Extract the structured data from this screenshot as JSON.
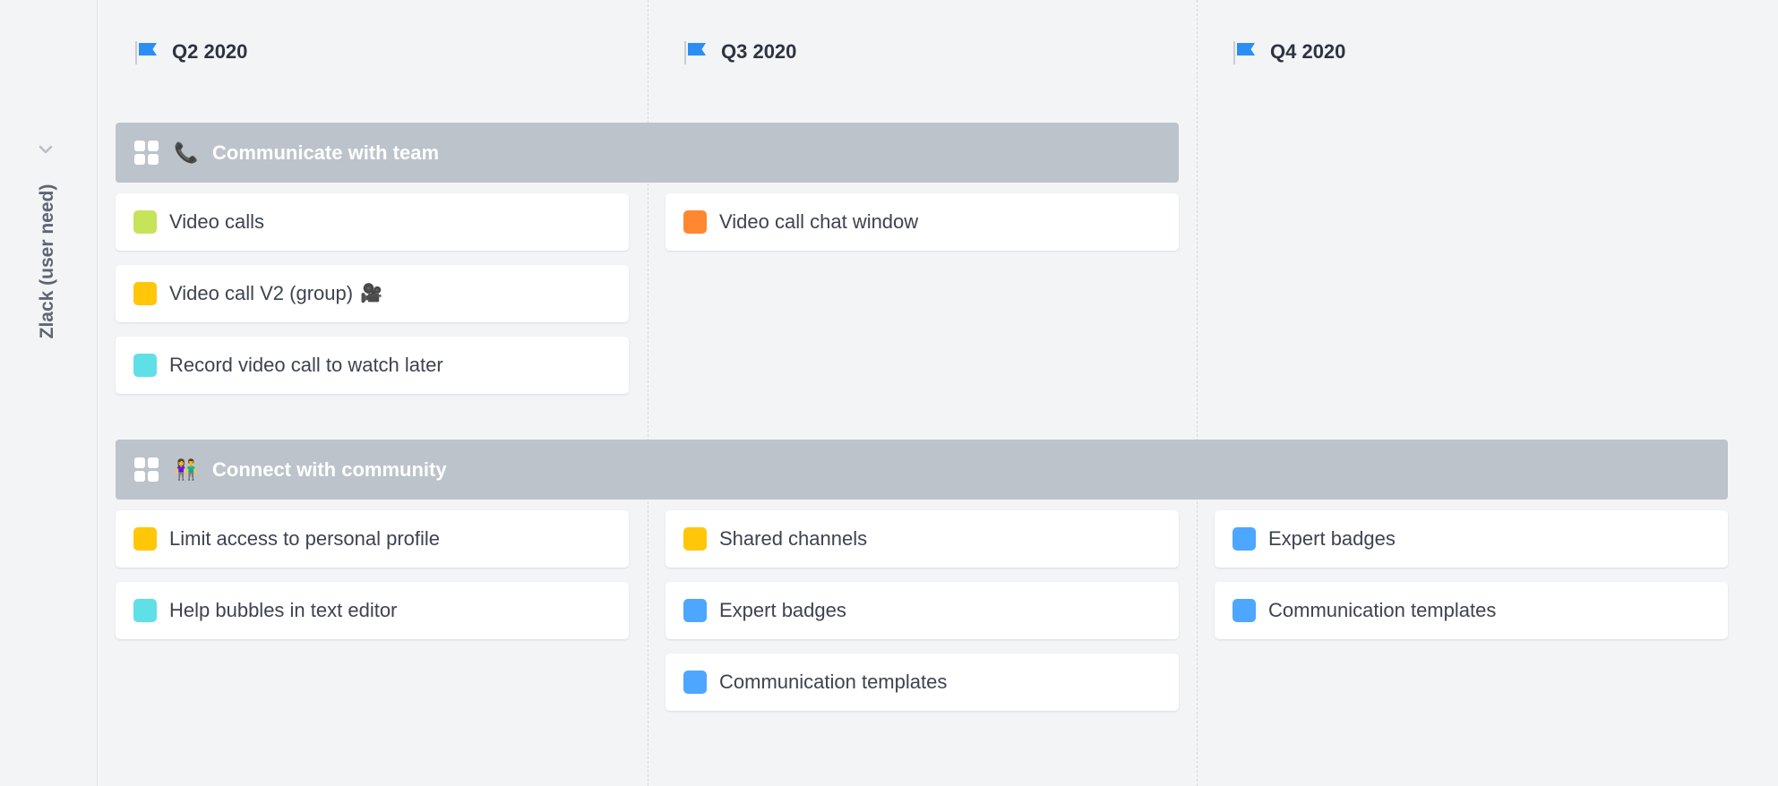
{
  "row": {
    "label": "Zlack (user need)"
  },
  "columns": [
    {
      "label": "Q2 2020",
      "flag_icon": "flag-icon"
    },
    {
      "label": "Q3 2020",
      "flag_icon": "flag-icon"
    },
    {
      "label": "Q4 2020",
      "flag_icon": "flag-icon"
    }
  ],
  "groups": [
    {
      "label": "Communicate with team",
      "icon": "phone-icon",
      "emoji": "📞",
      "cards": [
        {
          "label": "Video calls",
          "color": "#c7e35a",
          "column": "Q2 2020"
        },
        {
          "label": "Video call V2 (group)",
          "emoji": "🎥",
          "color": "#ffc60a",
          "column": "Q2 2020"
        },
        {
          "label": "Record video call to watch later",
          "color": "#5ee0e6",
          "column": "Q2 2020"
        },
        {
          "label": "Video call chat window",
          "color": "#ff8730",
          "column": "Q3 2020"
        }
      ]
    },
    {
      "label": "Connect with community",
      "icon": "people-icon",
      "emoji": "👫",
      "cards": [
        {
          "label": "Limit access to personal profile",
          "color": "#ffc60a",
          "column": "Q2 2020"
        },
        {
          "label": "Help bubbles in text editor",
          "color": "#5ee0e6",
          "column": "Q2 2020"
        },
        {
          "label": "Shared channels",
          "color": "#ffc60a",
          "column": "Q3 2020"
        },
        {
          "label": "Expert badges",
          "color": "#4da6ff",
          "column": "Q3 2020"
        },
        {
          "label": "Communication templates",
          "color": "#4da6ff",
          "column": "Q3 2020"
        },
        {
          "label": "Expert badges",
          "color": "#4da6ff",
          "column": "Q4 2020"
        },
        {
          "label": "Communication templates",
          "color": "#4da6ff",
          "column": "Q4 2020"
        }
      ]
    }
  ],
  "colors": {
    "background": "#f3f4f6",
    "group_bar": "#bdc3ca",
    "flag": "#2b8ef5",
    "yellow": "#ffc60a",
    "cyan": "#5ee0e6",
    "lime": "#c7e35a",
    "orange": "#ff8730",
    "blue": "#4da6ff"
  }
}
